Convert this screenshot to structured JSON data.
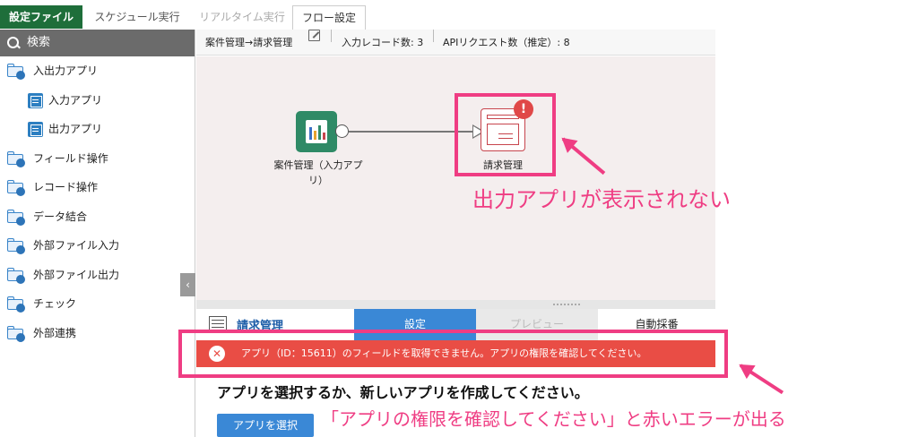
{
  "tabs": [
    {
      "label": "設定ファイル"
    },
    {
      "label": "スケジュール実行"
    },
    {
      "label": "リアルタイム実行"
    },
    {
      "label": "フロー設定"
    }
  ],
  "sidebar": {
    "search_label": "検索",
    "items": [
      {
        "label": "入出力アプリ"
      },
      {
        "label": "入力アプリ"
      },
      {
        "label": "出力アプリ"
      },
      {
        "label": "フィールド操作"
      },
      {
        "label": "レコード操作"
      },
      {
        "label": "データ結合"
      },
      {
        "label": "外部ファイル入力"
      },
      {
        "label": "外部ファイル出力"
      },
      {
        "label": "チェック"
      },
      {
        "label": "外部連携"
      }
    ]
  },
  "header": {
    "flow_name": "案件管理→請求管理",
    "input_records": "入力レコード数: 3",
    "api_requests": "APIリクエスト数（推定）: 8"
  },
  "flow": {
    "input_node_label": "案件管理（入力アプリ）",
    "output_node_label": "請求管理",
    "warning_mark": "!"
  },
  "panel": {
    "title": "請求管理",
    "tabs": [
      {
        "label": "設定"
      },
      {
        "label": "プレビュー"
      },
      {
        "label": "自動採番"
      }
    ],
    "error_message": "アプリ（ID：15611）のフィールドを取得できません。アプリの権限を確認してください。",
    "instruction": "アプリを選択するか、新しいアプリを作成してください。",
    "select_button": "アプリを選択"
  },
  "annotations": {
    "note1": "出力アプリが表示されない",
    "note2": "「アプリの権限を確認してください」と赤いエラーが出る"
  },
  "colors": {
    "accent_green": "#1e6e3a",
    "accent_blue": "#3a88d6",
    "error_red": "#e94d45",
    "annotation_pink": "#ef3d83"
  }
}
